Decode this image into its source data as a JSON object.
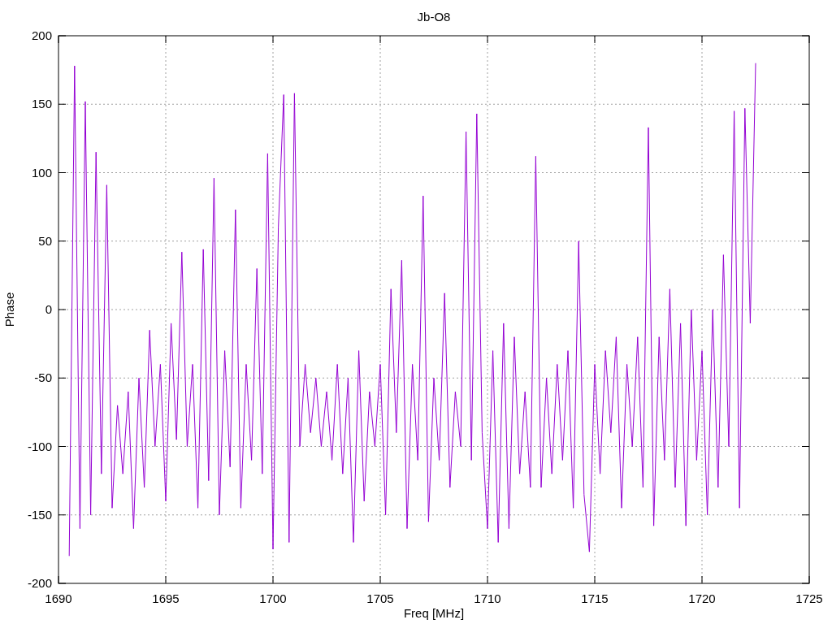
{
  "chart_data": {
    "type": "line",
    "grid": true,
    "title": "Jb-O8",
    "xlabel": "Freq [MHz]",
    "ylabel": "Phase",
    "xlim": [
      1690,
      1725
    ],
    "ylim": [
      -200,
      200
    ],
    "xticks": [
      1690,
      1695,
      1700,
      1705,
      1710,
      1715,
      1720,
      1725
    ],
    "yticks": [
      -200,
      -150,
      -100,
      -50,
      0,
      50,
      100,
      150,
      200
    ],
    "x": [
      1690.5,
      1690.75,
      1691,
      1691.25,
      1691.5,
      1691.75,
      1692,
      1692.25,
      1692.5,
      1692.75,
      1693,
      1693.25,
      1693.5,
      1693.75,
      1694,
      1694.25,
      1694.5,
      1694.75,
      1695,
      1695.25,
      1695.5,
      1695.75,
      1696,
      1696.25,
      1696.5,
      1696.75,
      1697,
      1697.25,
      1697.5,
      1697.75,
      1698,
      1698.25,
      1698.5,
      1698.75,
      1699,
      1699.25,
      1699.5,
      1699.75,
      1700,
      1700.25,
      1700.5,
      1700.75,
      1701,
      1701.25,
      1701.5,
      1701.75,
      1702,
      1702.25,
      1702.5,
      1702.75,
      1703,
      1703.25,
      1703.5,
      1703.75,
      1704,
      1704.25,
      1704.5,
      1704.75,
      1705,
      1705.25,
      1705.5,
      1705.75,
      1706,
      1706.25,
      1706.5,
      1706.75,
      1707,
      1707.25,
      1707.5,
      1707.75,
      1708,
      1708.25,
      1708.5,
      1708.75,
      1709,
      1709.25,
      1709.5,
      1709.75,
      1710,
      1710.25,
      1710.5,
      1710.75,
      1711,
      1711.25,
      1711.5,
      1711.75,
      1712,
      1712.25,
      1712.5,
      1712.75,
      1713,
      1713.25,
      1713.5,
      1713.75,
      1714,
      1714.25,
      1714.5,
      1714.75,
      1715,
      1715.25,
      1715.5,
      1715.75,
      1716,
      1716.25,
      1716.5,
      1716.75,
      1717,
      1717.25,
      1717.5,
      1717.75,
      1718,
      1718.25,
      1718.5,
      1718.75,
      1719,
      1719.25,
      1719.5,
      1719.75,
      1720,
      1720.25,
      1720.5,
      1720.75,
      1721,
      1721.25,
      1721.5,
      1721.75,
      1722,
      1722.25,
      1722.5
    ],
    "series": [
      {
        "color": "#9400d3",
        "values": [
          -180,
          178,
          -160,
          152,
          -150,
          115,
          -120,
          91,
          -145,
          -70,
          -120,
          -60,
          -160,
          -50,
          -130,
          -15,
          -100,
          -40,
          -140,
          -10,
          -95,
          42,
          -100,
          -40,
          -145,
          44,
          -125,
          96,
          -150,
          -30,
          -115,
          73,
          -145,
          -40,
          -110,
          30,
          -120,
          114,
          -175,
          60,
          157,
          -170,
          158,
          -100,
          -40,
          -90,
          -50,
          -100,
          -60,
          -110,
          -40,
          -120,
          -50,
          -170,
          -30,
          -140,
          -60,
          -100,
          -40,
          -150,
          15,
          -90,
          36,
          -160,
          -40,
          -110,
          83,
          -155,
          -50,
          -110,
          12,
          -130,
          -60,
          -100,
          130,
          -110,
          143,
          -90,
          -160,
          -30,
          -170,
          -10,
          -160,
          -20,
          -120,
          -60,
          -130,
          112,
          -130,
          -50,
          -120,
          -40,
          -110,
          -30,
          -145,
          50,
          -135,
          -177,
          -40,
          -120,
          -30,
          -90,
          -20,
          -145,
          -40,
          -100,
          -20,
          -130,
          133,
          -158,
          -20,
          -110,
          15,
          -130,
          -10,
          -158,
          0,
          -110,
          -30,
          -150,
          0,
          -130,
          40,
          -100,
          145,
          -145,
          147,
          -10,
          180
        ]
      }
    ]
  }
}
